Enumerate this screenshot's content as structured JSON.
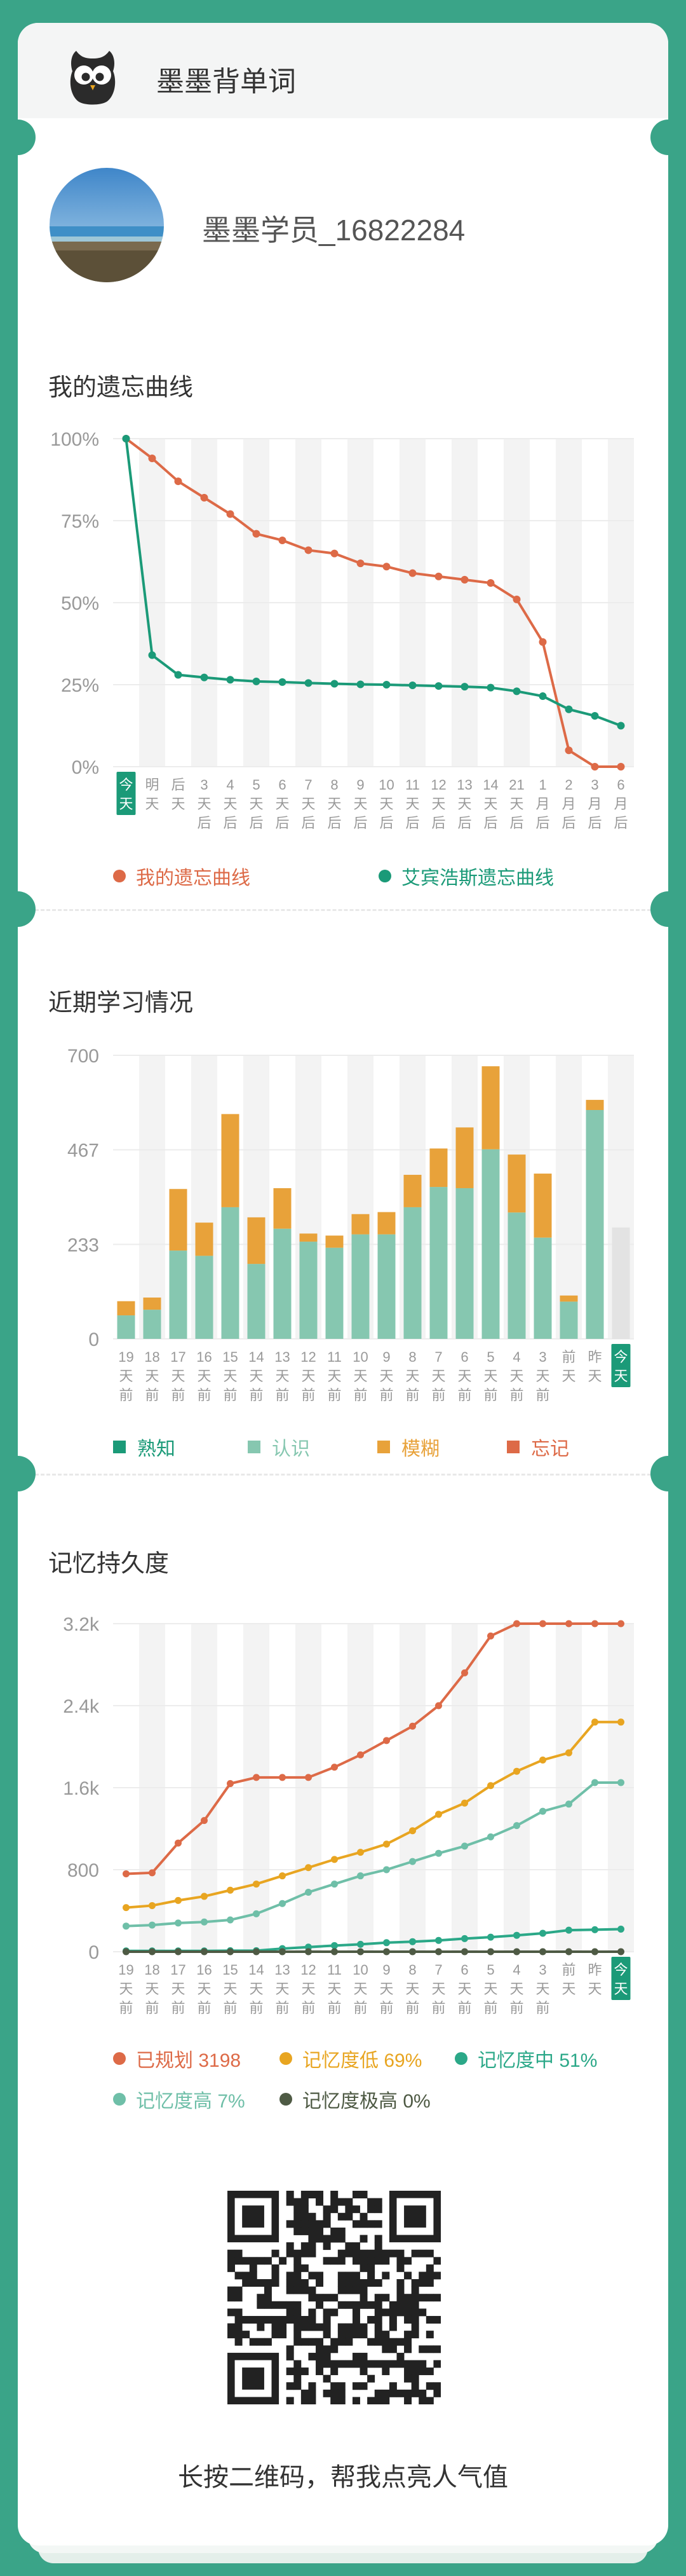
{
  "app": {
    "title": "墨墨背单词"
  },
  "profile": {
    "username": "墨墨学员_16822284"
  },
  "sections": {
    "forgetting": "我的遗忘曲线",
    "recent": "近期学习情况",
    "memory": "记忆持久度"
  },
  "colors": {
    "brand": "#3aa488",
    "green_dark": "#1b9a78",
    "green_light": "#86c7b0",
    "orange": "#e8a23a",
    "red": "#dd6a47",
    "gold": "#e8a521",
    "teal_mid": "#2ba888",
    "teal_light": "#6fbfa8",
    "teal_dark": "#4a9a8e",
    "olive": "#4e5a44",
    "grid_stripe": "#f3f3f3",
    "today_bar": "#e3e3e3"
  },
  "chart_data": [
    {
      "type": "line",
      "title": "我的遗忘曲线",
      "x_ticks": [
        [
          "今",
          "天"
        ],
        [
          "明",
          "天"
        ],
        [
          "后",
          "天"
        ],
        [
          "3",
          "天",
          "后"
        ],
        [
          "4",
          "天",
          "后"
        ],
        [
          "5",
          "天",
          "后"
        ],
        [
          "6",
          "天",
          "后"
        ],
        [
          "7",
          "天",
          "后"
        ],
        [
          "8",
          "天",
          "后"
        ],
        [
          "9",
          "天",
          "后"
        ],
        [
          "10",
          "天",
          "后"
        ],
        [
          "11",
          "天",
          "后"
        ],
        [
          "12",
          "天",
          "后"
        ],
        [
          "13",
          "天",
          "后"
        ],
        [
          "14",
          "天",
          "后"
        ],
        [
          "21",
          "天",
          "后"
        ],
        [
          "1",
          "月",
          "后"
        ],
        [
          "2",
          "月",
          "后"
        ],
        [
          "3",
          "月",
          "后"
        ],
        [
          "6",
          "月",
          "后"
        ]
      ],
      "highlight_index": 0,
      "y_ticks": [
        "100%",
        "75%",
        "50%",
        "25%",
        "0%"
      ],
      "ylim": [
        0,
        100
      ],
      "series": [
        {
          "name": "我的遗忘曲线",
          "color": "#dd6a47",
          "values": [
            100,
            94,
            87,
            82,
            77,
            71,
            69,
            66,
            65,
            62,
            61,
            59,
            58,
            57,
            56,
            51,
            38,
            5,
            0,
            0
          ]
        },
        {
          "name": "艾宾浩斯遗忘曲线",
          "color": "#1b9a78",
          "values": [
            100,
            34,
            28,
            27.2,
            26.5,
            26,
            25.8,
            25.5,
            25.3,
            25.1,
            25,
            24.8,
            24.6,
            24.4,
            24.1,
            23,
            21.5,
            17.5,
            15.5,
            12.5
          ]
        }
      ]
    },
    {
      "type": "bar",
      "title": "近期学习情况",
      "x_ticks": [
        [
          "19",
          "天",
          "前"
        ],
        [
          "18",
          "天",
          "前"
        ],
        [
          "17",
          "天",
          "前"
        ],
        [
          "16",
          "天",
          "前"
        ],
        [
          "15",
          "天",
          "前"
        ],
        [
          "14",
          "天",
          "前"
        ],
        [
          "13",
          "天",
          "前"
        ],
        [
          "12",
          "天",
          "前"
        ],
        [
          "11",
          "天",
          "前"
        ],
        [
          "10",
          "天",
          "前"
        ],
        [
          "9",
          "天",
          "前"
        ],
        [
          "8",
          "天",
          "前"
        ],
        [
          "7",
          "天",
          "前"
        ],
        [
          "6",
          "天",
          "前"
        ],
        [
          "5",
          "天",
          "前"
        ],
        [
          "4",
          "天",
          "前"
        ],
        [
          "3",
          "天",
          "前"
        ],
        [
          "前",
          "天"
        ],
        [
          "昨",
          "天"
        ],
        [
          "今",
          "天"
        ]
      ],
      "highlight_index": 19,
      "y_ticks": [
        "700",
        "467",
        "233",
        "0"
      ],
      "ylim": [
        0,
        700
      ],
      "series": [
        {
          "name": "熟知",
          "color": "#1b9a78",
          "values": [
            0,
            0,
            0,
            0,
            0,
            0,
            0,
            0,
            0,
            0,
            0,
            0,
            0,
            0,
            0,
            0,
            0,
            0,
            0,
            0
          ]
        },
        {
          "name": "认识",
          "color": "#86c7b0",
          "values": [
            58,
            72,
            218,
            205,
            325,
            185,
            272,
            240,
            225,
            258,
            258,
            325,
            375,
            372,
            468,
            312,
            250,
            92,
            565,
            0
          ]
        },
        {
          "name": "模糊",
          "color": "#e8a23a",
          "values": [
            35,
            30,
            152,
            82,
            230,
            115,
            100,
            20,
            30,
            50,
            55,
            80,
            95,
            150,
            205,
            143,
            158,
            15,
            25,
            0
          ]
        },
        {
          "name": "忘记",
          "color": "#dd6a47",
          "values": [
            0,
            0,
            0,
            0,
            0,
            0,
            0,
            0,
            0,
            0,
            0,
            0,
            0,
            0,
            0,
            0,
            0,
            0,
            0,
            0
          ]
        }
      ],
      "today_placeholder": 275
    },
    {
      "type": "line",
      "title": "记忆持久度",
      "x_ticks": [
        [
          "19",
          "天",
          "前"
        ],
        [
          "18",
          "天",
          "前"
        ],
        [
          "17",
          "天",
          "前"
        ],
        [
          "16",
          "天",
          "前"
        ],
        [
          "15",
          "天",
          "前"
        ],
        [
          "14",
          "天",
          "前"
        ],
        [
          "13",
          "天",
          "前"
        ],
        [
          "12",
          "天",
          "前"
        ],
        [
          "11",
          "天",
          "前"
        ],
        [
          "10",
          "天",
          "前"
        ],
        [
          "9",
          "天",
          "前"
        ],
        [
          "8",
          "天",
          "前"
        ],
        [
          "7",
          "天",
          "前"
        ],
        [
          "6",
          "天",
          "前"
        ],
        [
          "5",
          "天",
          "前"
        ],
        [
          "4",
          "天",
          "前"
        ],
        [
          "3",
          "天",
          "前"
        ],
        [
          "前",
          "天"
        ],
        [
          "昨",
          "天"
        ],
        [
          "今",
          "天"
        ]
      ],
      "highlight_index": 19,
      "y_ticks": [
        "3.2k",
        "2.4k",
        "1.6k",
        "800",
        "0"
      ],
      "ylim": [
        0,
        3200
      ],
      "series": [
        {
          "name": "已规划 3198",
          "color": "#dd6a47",
          "values": [
            760,
            770,
            1060,
            1280,
            1640,
            1700,
            1700,
            1700,
            1800,
            1920,
            2060,
            2200,
            2400,
            2720,
            3080,
            3200,
            3200,
            3200,
            3200,
            3200
          ]
        },
        {
          "name": "记忆度低 69%",
          "color": "#e8a521",
          "values": [
            430,
            450,
            500,
            540,
            600,
            660,
            740,
            820,
            900,
            970,
            1050,
            1180,
            1340,
            1450,
            1620,
            1760,
            1870,
            1940,
            2240,
            2240
          ]
        },
        {
          "name": "记忆度中 51%",
          "color": "#2ba888",
          "values": [
            8,
            8,
            8,
            8,
            10,
            10,
            30,
            45,
            60,
            72,
            88,
            98,
            110,
            128,
            142,
            160,
            180,
            210,
            215,
            220
          ]
        },
        {
          "name": "记忆度高 7%",
          "color": "#6fbfa8",
          "values": [
            250,
            260,
            280,
            290,
            310,
            370,
            470,
            580,
            660,
            740,
            800,
            880,
            960,
            1030,
            1120,
            1230,
            1370,
            1440,
            1650,
            1650
          ]
        },
        {
          "name": "记忆度极高 0%",
          "color": "#4e5a44",
          "values": [
            0,
            0,
            0,
            0,
            0,
            0,
            0,
            0,
            0,
            0,
            0,
            0,
            0,
            0,
            0,
            0,
            0,
            0,
            0,
            0
          ]
        }
      ]
    }
  ],
  "share": {
    "caption": "长按二维码，帮我点亮人气值"
  }
}
